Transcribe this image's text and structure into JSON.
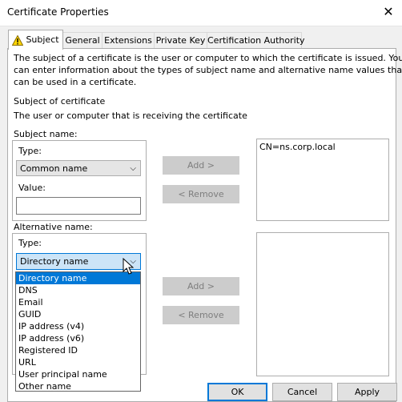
{
  "window": {
    "title": "Certificate Properties"
  },
  "tabs": [
    {
      "label": "Subject"
    },
    {
      "label": "General"
    },
    {
      "label": "Extensions"
    },
    {
      "label": "Private Key"
    },
    {
      "label": "Certification Authority"
    }
  ],
  "intro": {
    "line1": "The subject of a certificate is the user or computer to which the certificate is issued. You",
    "line2": "can enter information about the types of subject name and alternative name values that",
    "line3": "can be used in a certificate."
  },
  "subject_of_certificate": {
    "heading": "Subject of certificate",
    "description": "The user or computer that is receiving the certificate"
  },
  "subject_name": {
    "label": "Subject name:",
    "type_label": "Type:",
    "type_value": "Common name",
    "value_label": "Value:",
    "value_text": ""
  },
  "subject_buttons": {
    "add": "Add >",
    "remove": "< Remove"
  },
  "subject_list": {
    "items": [
      "CN=ns.corp.local"
    ]
  },
  "alternative_name": {
    "label": "Alternative name:",
    "type_label": "Type:",
    "type_value": "Directory name",
    "options": [
      "Directory name",
      "DNS",
      "Email",
      "GUID",
      "IP address (v4)",
      "IP address (v6)",
      "Registered ID",
      "URL",
      "User principal name",
      "Other name"
    ],
    "selected_index": 0
  },
  "alt_buttons": {
    "add": "Add >",
    "remove": "< Remove"
  },
  "footer": {
    "ok": "OK",
    "cancel": "Cancel",
    "apply": "Apply"
  },
  "colors": {
    "accent": "#0078d7",
    "selection_bg": "#cce4f7"
  }
}
